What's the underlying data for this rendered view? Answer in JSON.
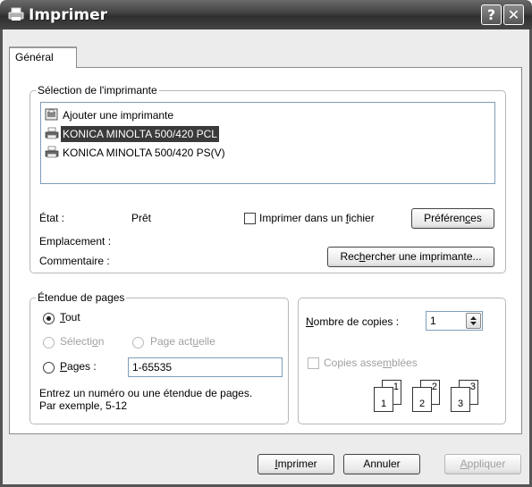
{
  "window": {
    "title": "Imprimer",
    "help_glyph": "?",
    "close_glyph": "✕"
  },
  "tabs": [
    {
      "label": "Général"
    }
  ],
  "printer_group": {
    "legend": "Sélection de l'imprimante",
    "items": [
      {
        "label": "Ajouter une imprimante",
        "icon": "add-printer-icon",
        "selected": false
      },
      {
        "label": "KONICA MINOLTA 500/420 PCL",
        "icon": "printer-icon",
        "selected": true
      },
      {
        "label": "KONICA MINOLTA 500/420 PS(V)",
        "icon": "printer-icon",
        "selected": false
      }
    ],
    "status_label": "État :",
    "status_value": "Prêt",
    "location_label": "Emplacement :",
    "comment_label": "Commentaire :",
    "print_to_file": {
      "pre": "Imprimer dans un ",
      "accel": "f",
      "post": "ichier",
      "checked": false
    },
    "preferences": {
      "pre": "Préféren",
      "accel": "c",
      "post": "es"
    },
    "find_printer": {
      "pre": "Rec",
      "accel": "h",
      "post": "ercher une imprimante..."
    }
  },
  "range_group": {
    "legend": "Étendue de pages",
    "all": {
      "accel": "T",
      "post": "out",
      "selected": true
    },
    "selection": {
      "pre": "Sélecti",
      "accel": "o",
      "post": "n",
      "enabled": false
    },
    "current_page": {
      "pre": "Page act",
      "accel": "u",
      "post": "elle",
      "enabled": false
    },
    "pages": {
      "accel": "P",
      "post": "ages :",
      "value": "1-65535"
    },
    "hint_line1": "Entrez un numéro ou une étendue de pages.",
    "hint_line2": "Par exemple, 5-12"
  },
  "copies_group": {
    "copies_label": {
      "accel": "N",
      "post": "ombre de copies :"
    },
    "copies_value": "1",
    "collate": {
      "pre": "Copies asse",
      "accel": "m",
      "post": "blées",
      "checked": false,
      "enabled": false
    },
    "collate_digits": [
      "1",
      "1",
      "2",
      "2",
      "3",
      "3"
    ]
  },
  "footer": {
    "print": {
      "accel": "I",
      "post": "mprimer"
    },
    "cancel": "Annuler",
    "apply": {
      "accel": "A",
      "post": "ppliquer",
      "enabled": false
    }
  },
  "colors": {
    "selection_bg": "#3a3a3a",
    "titlebar": "#404040",
    "dialog_bg": "#ececec",
    "disabled_text": "#a0a0a0"
  }
}
